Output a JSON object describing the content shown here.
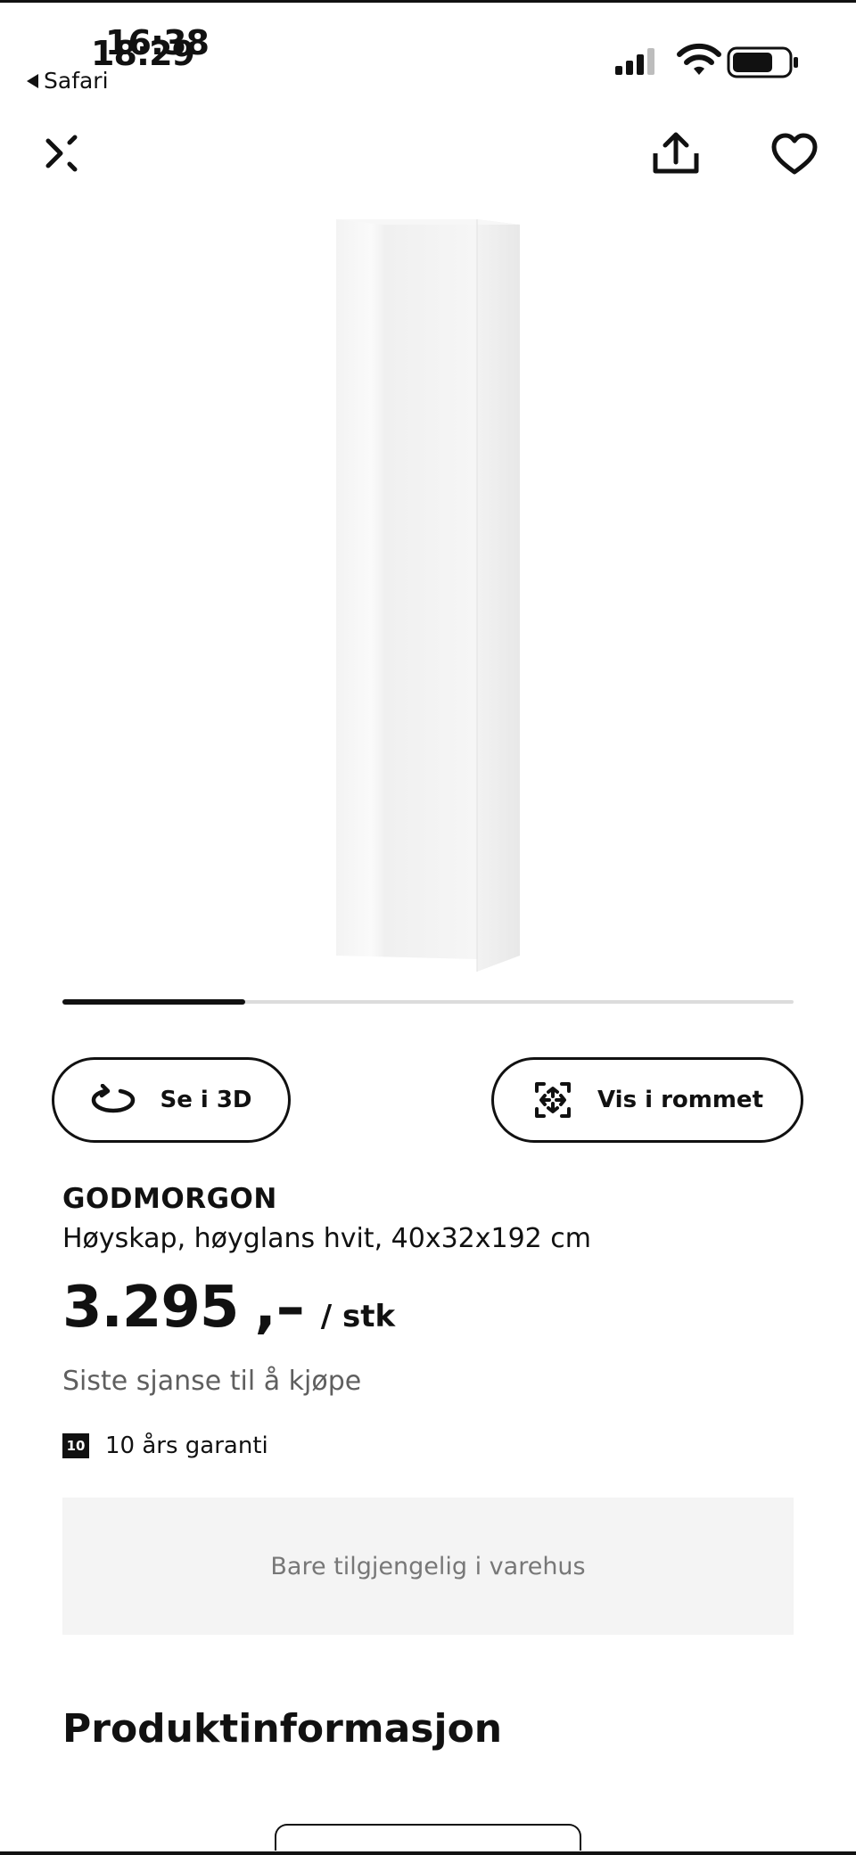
{
  "status_bar": {
    "time_primary": "16:38",
    "time_overlay": "18:29",
    "back_app_label": "Safari"
  },
  "nav": {
    "close_icon": "close-collapse-icon",
    "share_icon": "share-icon",
    "favorite_icon": "heart-icon"
  },
  "gallery": {
    "image_count_progress": 0.25
  },
  "actions": {
    "view_3d_label": "Se i 3D",
    "view_room_label": "Vis i rommet"
  },
  "product": {
    "name": "GODMORGON",
    "description": "Høyskap, høyglans hvit, 40x32x192 cm",
    "price": "3.295",
    "price_suffix": ",–",
    "price_unit": "/ stk",
    "status_note": "Siste sjanse til å kjøpe",
    "warranty_badge": "10",
    "warranty_text": "10 års garanti",
    "availability": "Bare tilgjengelig i varehus"
  },
  "sections": {
    "product_info_title": "Produktinformasjon"
  },
  "colors": {
    "text": "#111111",
    "muted": "#5f5f5f",
    "panel": "#f4f4f4"
  }
}
